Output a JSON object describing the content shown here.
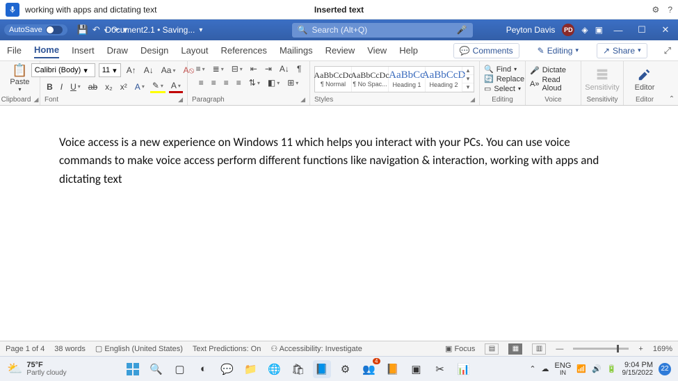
{
  "voice_bar": {
    "command_text": "working with apps and dictating text",
    "center_text": "Inserted text"
  },
  "title": {
    "autosave_label": "AutoSave",
    "doc_name": "Document2.1 • Saving...",
    "search_placeholder": "Search (Alt+Q)",
    "user_name": "Peyton Davis",
    "user_initials": "PD"
  },
  "tabs": {
    "items": [
      "File",
      "Home",
      "Insert",
      "Draw",
      "Design",
      "Layout",
      "References",
      "Mailings",
      "Review",
      "View",
      "Help"
    ],
    "active": "Home",
    "comments": "Comments",
    "editing": "Editing",
    "share": "Share"
  },
  "ribbon": {
    "clipboard": {
      "label": "Clipboard",
      "paste": "Paste"
    },
    "font": {
      "label": "Font",
      "family": "Calibri (Body)",
      "size": "11"
    },
    "paragraph": {
      "label": "Paragraph"
    },
    "styles": {
      "label": "Styles",
      "items": [
        {
          "preview": "AaBbCcDc",
          "name": "¶ Normal"
        },
        {
          "preview": "AaBbCcDc",
          "name": "¶ No Spac..."
        },
        {
          "preview": "AaBbCc",
          "name": "Heading 1",
          "big": true
        },
        {
          "preview": "AaBbCcD",
          "name": "Heading 2",
          "big": true
        }
      ]
    },
    "editing": {
      "label": "Editing",
      "find": "Find",
      "replace": "Replace",
      "select": "Select"
    },
    "voice": {
      "label": "Voice",
      "dictate": "Dictate",
      "read": "Read Aloud"
    },
    "sensitivity": {
      "label": "Sensitivity",
      "btn": "Sensitivity"
    },
    "editor": {
      "label": "Editor",
      "btn": "Editor"
    }
  },
  "document": {
    "paragraph": "Voice access is a new experience on Windows 11 which helps you interact with your PCs. You can use voice commands to make voice access perform different functions like navigation & interaction, working with apps and dictating text"
  },
  "status": {
    "page": "Page 1 of 4",
    "words": "38 words",
    "lang": "English (United States)",
    "predictions": "Text Predictions: On",
    "accessibility": "Accessibility: Investigate",
    "focus": "Focus",
    "zoom": "169%"
  },
  "taskbar": {
    "temp": "75°F",
    "weather": "Partly cloudy",
    "lang1": "ENG",
    "lang2": "IN",
    "time": "9:04 PM",
    "date": "9/15/2022",
    "notif_count": "22",
    "teams_badge": "4"
  }
}
